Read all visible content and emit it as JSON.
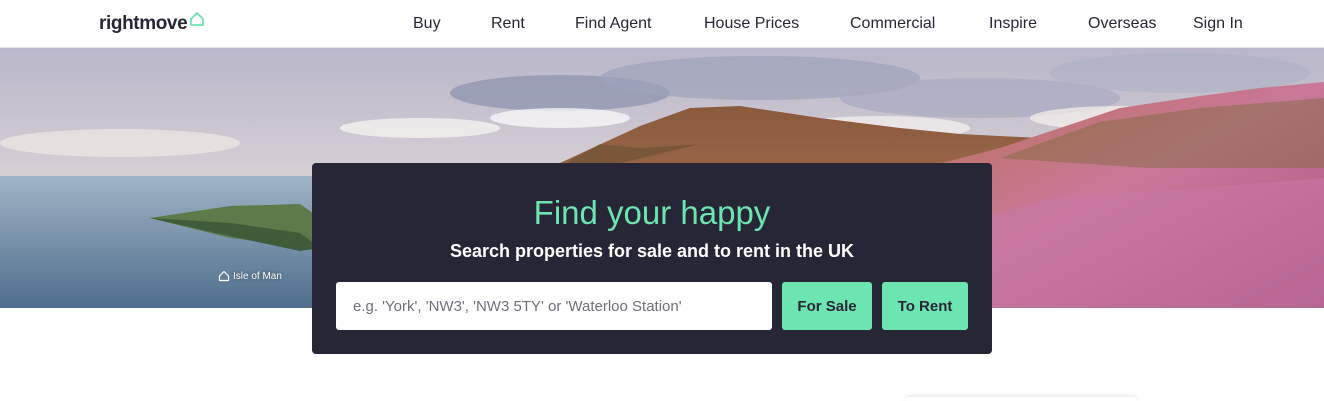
{
  "brand": {
    "name": "rightmove",
    "accent": "#6ce5b1",
    "dark": "#262637",
    "logo_icon": "house-outline-icon"
  },
  "nav": {
    "buy": "Buy",
    "rent": "Rent",
    "find_agent": "Find Agent",
    "house_prices": "House Prices",
    "commercial": "Commercial",
    "inspire": "Inspire",
    "overseas": "Overseas",
    "sign_in": "Sign In"
  },
  "hero": {
    "location_caption": "Isle of Man",
    "caption_icon": "house-outline-icon"
  },
  "search_panel": {
    "headline": "Find your happy",
    "subheadline": "Search properties for sale and to rent in the UK",
    "placeholder": "e.g. 'York', 'NW3', 'NW3 5TY' or 'Waterloo Station'",
    "value": "",
    "for_sale_label": "For Sale",
    "to_rent_label": "To Rent"
  }
}
